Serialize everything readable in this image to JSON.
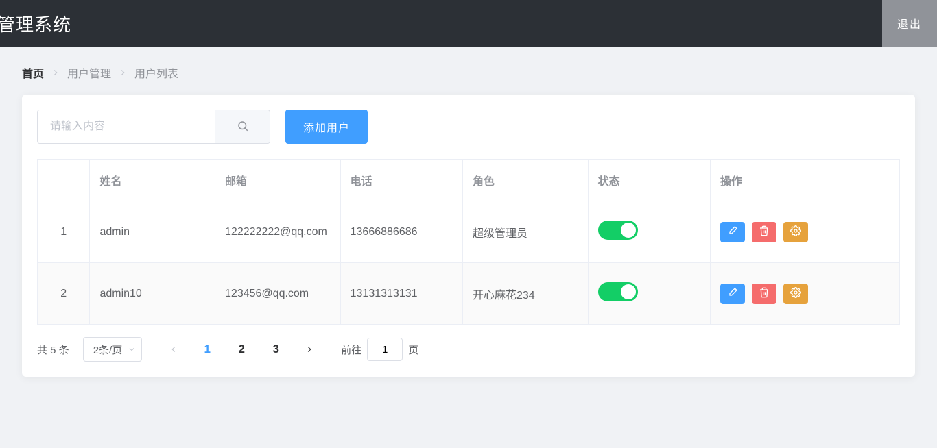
{
  "header": {
    "title": "管理系统",
    "logout": "退出"
  },
  "breadcrumb": {
    "items": [
      "首页",
      "用户管理",
      "用户列表"
    ]
  },
  "toolbar": {
    "search_placeholder": "请输入内容",
    "add_user": "添加用户"
  },
  "table": {
    "headers": {
      "index": "",
      "name": "姓名",
      "email": "邮箱",
      "phone": "电话",
      "role": "角色",
      "state": "状态",
      "ops": "操作"
    },
    "rows": [
      {
        "index": "1",
        "name": "admin",
        "email": "122222222@qq.com",
        "phone": "13666886686",
        "role": "超级管理员",
        "state_on": true
      },
      {
        "index": "2",
        "name": "admin10",
        "email": "123456@qq.com",
        "phone": "13131313131",
        "role": "开心麻花234",
        "state_on": true
      }
    ]
  },
  "pagination": {
    "total_label": "共 5 条",
    "page_size_label": "2条/页",
    "pages": [
      "1",
      "2",
      "3"
    ],
    "current_page": "1",
    "goto_prefix": "前往",
    "goto_value": "1",
    "goto_suffix": "页"
  }
}
